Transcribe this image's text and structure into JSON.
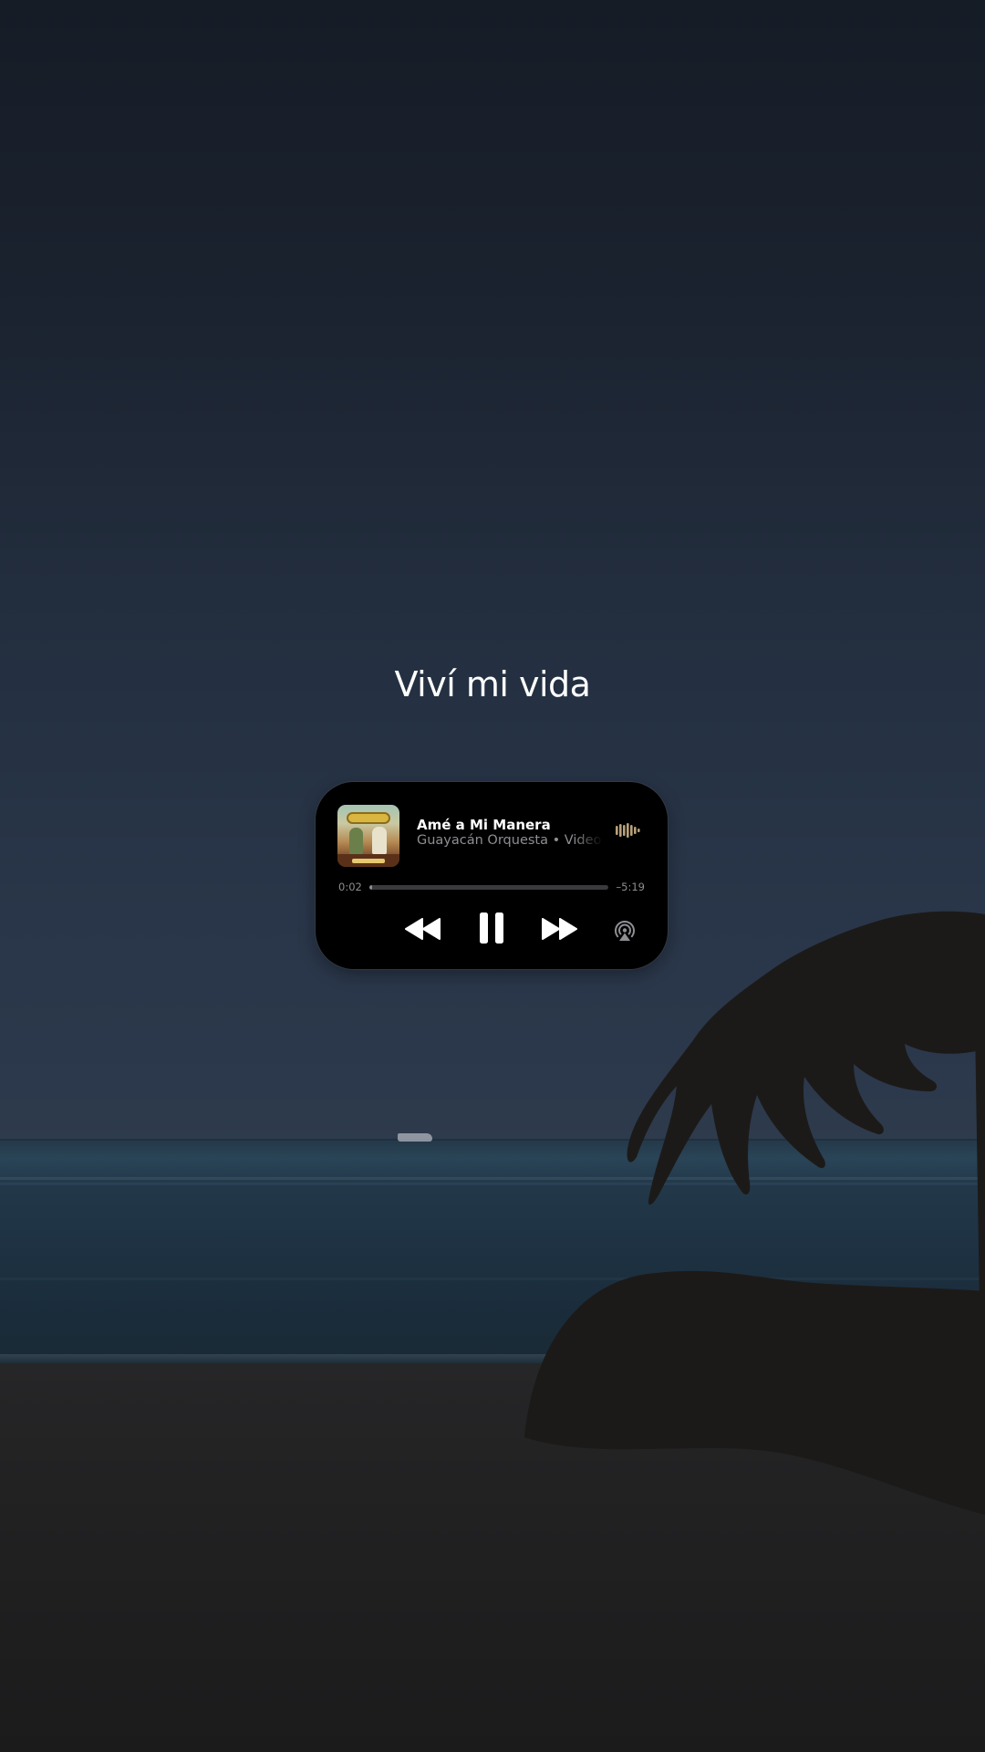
{
  "title": "Viví mi vida",
  "now_playing": {
    "song_title": "Amé a Mi Manera",
    "subtitle": "Guayacán Orquesta • Video dis",
    "elapsed": "0:02",
    "remaining": "–5:19",
    "progress_fraction": 0.006,
    "is_playing": true
  },
  "icons": {
    "artwork": "album-artwork",
    "waveform": "audio-waveform-icon",
    "rewind": "rewind-icon",
    "pause": "pause-icon",
    "forward": "fast-forward-icon",
    "airplay": "airplay-icon"
  },
  "colors": {
    "widget_background": "#000000",
    "primary_text": "#ffffff",
    "secondary_text": "#8e8e93",
    "waveform": "#b8a17a"
  }
}
